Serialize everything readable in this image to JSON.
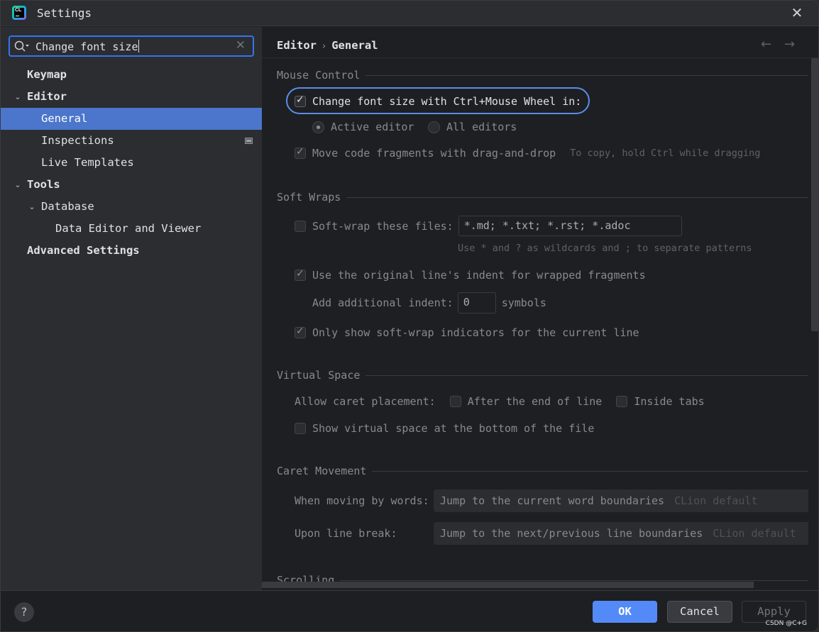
{
  "window": {
    "title": "Settings",
    "app_icon": "clion-icon",
    "close_glyph": "✕"
  },
  "sidebar": {
    "search": {
      "value": "Change font size",
      "clear_glyph": "✕"
    },
    "tree": [
      {
        "label": "Keymap",
        "level": 0,
        "bold": true,
        "expanded": null
      },
      {
        "label": "Editor",
        "level": 0,
        "bold": true,
        "expanded": true
      },
      {
        "label": "General",
        "level": 1,
        "bold": false,
        "selected": true
      },
      {
        "label": "Inspections",
        "level": 1,
        "bold": false,
        "badge": "project-scope-icon"
      },
      {
        "label": "Live Templates",
        "level": 1,
        "bold": false
      },
      {
        "label": "Tools",
        "level": 0,
        "bold": true,
        "expanded": true
      },
      {
        "label": "Database",
        "level": 1,
        "bold": false,
        "expanded": true
      },
      {
        "label": "Data Editor and Viewer",
        "level": 2,
        "bold": false
      },
      {
        "label": "Advanced Settings",
        "level": 0,
        "bold": true
      }
    ]
  },
  "header": {
    "breadcrumb": [
      "Editor",
      "General"
    ],
    "breadcrumb_sep": "›",
    "back_glyph": "←",
    "forward_glyph": "→"
  },
  "sections": {
    "mouse_control": {
      "title": "Mouse Control",
      "change_font_size": {
        "label": "Change font size with Ctrl+Mouse Wheel in:",
        "checked": true
      },
      "radio_active_editor": {
        "label": "Active editor",
        "selected": true
      },
      "radio_all_editors": {
        "label": "All editors",
        "selected": false
      },
      "move_code": {
        "label": "Move code fragments with drag-and-drop",
        "checked": true,
        "hint": "To copy, hold Ctrl while dragging"
      }
    },
    "soft_wraps": {
      "title": "Soft Wraps",
      "soft_wrap_files": {
        "label": "Soft-wrap these files:",
        "checked": false,
        "value": "*.md; *.txt; *.rst; *.adoc",
        "hint": "Use * and ? as wildcards and ; to separate patterns"
      },
      "original_indent": {
        "label": "Use the original line's indent for wrapped fragments",
        "checked": true
      },
      "additional_indent": {
        "label": "Add additional indent:",
        "value": "0",
        "suffix": "symbols"
      },
      "indicators": {
        "label": "Only show soft-wrap indicators for the current line",
        "checked": true
      }
    },
    "virtual_space": {
      "title": "Virtual Space",
      "allow_caret_label": "Allow caret placement:",
      "after_end": {
        "label": "After the end of line",
        "checked": false
      },
      "inside_tabs": {
        "label": "Inside tabs",
        "checked": false
      },
      "show_virtual": {
        "label": "Show virtual space at the bottom of the file",
        "checked": false
      }
    },
    "caret_movement": {
      "title": "Caret Movement",
      "moving_by_words": {
        "label": "When moving by words:",
        "value": "Jump to the current word boundaries",
        "default_hint": "CLion default"
      },
      "line_break": {
        "label": "Upon line break:",
        "value": "Jump to the next/previous line boundaries",
        "default_hint": "CLion default"
      }
    },
    "scrolling": {
      "title": "Scrolling"
    }
  },
  "footer": {
    "help_label": "?",
    "ok_label": "OK",
    "cancel_label": "Cancel",
    "apply_label": "Apply",
    "watermark": "CSDN @C+G"
  },
  "colors": {
    "accent": "#3574f0",
    "selection": "#4b76cc",
    "ok_button": "#548af7",
    "highlight_ring": "#5a8de8"
  }
}
